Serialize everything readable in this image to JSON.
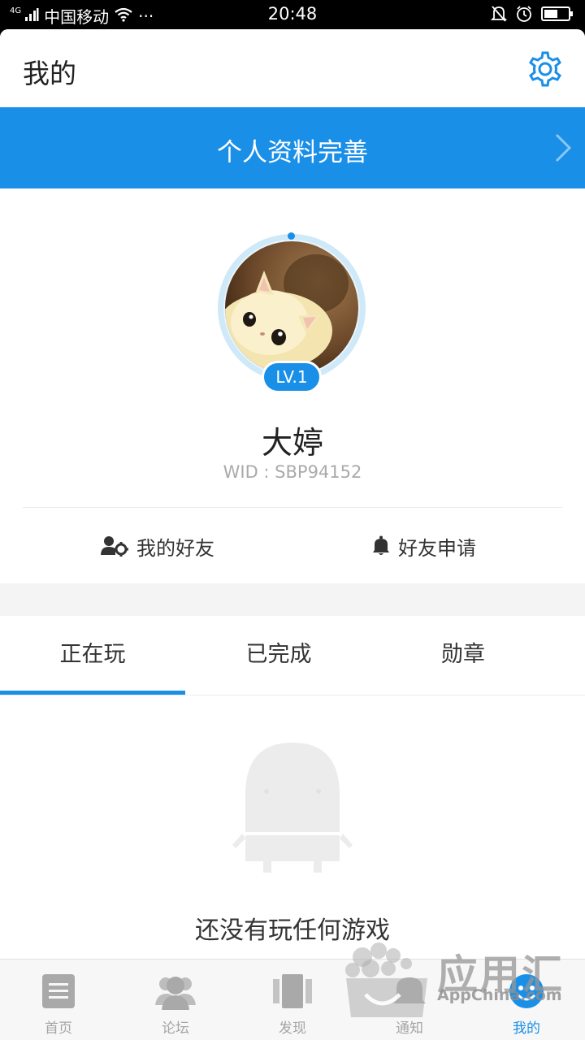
{
  "status_bar": {
    "network": "4G",
    "carrier": "中国移动",
    "more": "···",
    "time": "20:48"
  },
  "header": {
    "title": "我的"
  },
  "banner": {
    "label": "个人资料完善"
  },
  "profile": {
    "level": "LV.1",
    "name": "大婷",
    "wid": "WID : SBP94152",
    "friends_label": "我的好友",
    "requests_label": "好友申请"
  },
  "tabs": [
    {
      "label": "正在玩"
    },
    {
      "label": "已完成"
    },
    {
      "label": "勋章"
    }
  ],
  "empty_state": {
    "message": "还没有玩任何游戏"
  },
  "bottom_nav": [
    {
      "label": "首页",
      "icon": "home-doc-icon"
    },
    {
      "label": "论坛",
      "icon": "forum-people-icon"
    },
    {
      "label": "发现",
      "icon": "discover-cards-icon"
    },
    {
      "label": "通知",
      "icon": "notification-icon"
    },
    {
      "label": "我的",
      "icon": "me-face-icon"
    }
  ],
  "watermark": {
    "text_cn": "应用汇",
    "text_en": "AppChina.com"
  },
  "colors": {
    "accent": "#1a8fe8",
    "text_primary": "#222222",
    "text_muted": "#aaaaaa"
  }
}
